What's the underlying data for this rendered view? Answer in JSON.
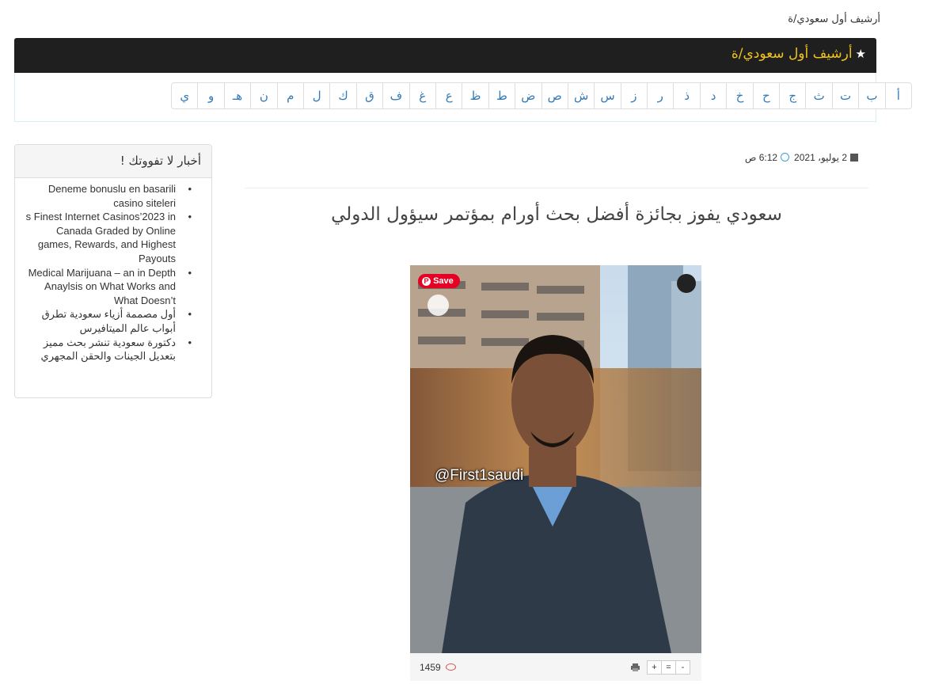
{
  "breadcrumb": "أرشيف أول سعودي/ة",
  "archive_panel": {
    "title": "أرشيف أول سعودي/ة",
    "letters": [
      "أ",
      "ب",
      "ت",
      "ث",
      "ج",
      "ح",
      "خ",
      "د",
      "ذ",
      "ر",
      "ز",
      "س",
      "ش",
      "ص",
      "ض",
      "ط",
      "ظ",
      "ع",
      "غ",
      "ف",
      "ق",
      "ك",
      "ل",
      "م",
      "ن",
      "هـ",
      "و",
      "ي"
    ]
  },
  "sidebar": {
    "title": "أخبار لا تفووتك !",
    "items": [
      "Deneme bonuslu en basarili casino siteleri",
      "s Finest Internet Casinos’2023 in Canada Graded by Online games, Rewards, and Highest Payouts",
      "Medical Marijuana – an in Depth Anaylsis on What Works and What Doesn’t",
      "أول مصممة أزياء سعودية تطرق أبواب عالم الميتافيرس",
      "دكتورة سعودية تنشر بحث مميز بتعديل الجينات والحقن المجهري"
    ]
  },
  "article": {
    "date": "2 يوليو، 2021",
    "time": "6:12 ص",
    "title": "سعودي يفوز بجائزة أفضل بحث أورام بمؤتمر سيؤول الدولي",
    "image_watermark": "@First1saudi",
    "save_label": "Save",
    "views": "1459",
    "font_controls": [
      "+",
      "=",
      "-"
    ]
  },
  "icons": {
    "calendar": "calendar-icon",
    "clock": "clock-icon",
    "eye": "eye-icon",
    "print": "print-icon",
    "star": "star-icon"
  },
  "colors": {
    "header_bg": "#1f1f1f",
    "header_text": "#f0c419",
    "link": "#337ab7",
    "pinterest": "#e60023"
  }
}
